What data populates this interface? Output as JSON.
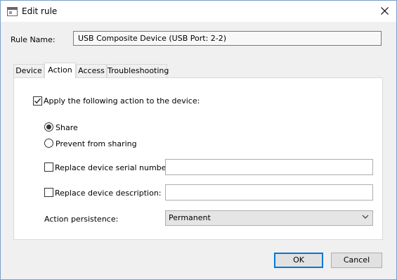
{
  "window": {
    "title": "Edit rule"
  },
  "rule": {
    "label": "Rule Name:",
    "value": "USB Composite Device (USB Port: 2-2)"
  },
  "tabs": [
    {
      "label": "Device",
      "active": false
    },
    {
      "label": "Action",
      "active": true
    },
    {
      "label": "Access",
      "active": false
    },
    {
      "label": "Troubleshooting",
      "active": false
    }
  ],
  "action": {
    "apply_label": "Apply the following action to the device:",
    "apply_checked": true,
    "share_label": "Share",
    "share_selected": true,
    "prevent_label": "Prevent from sharing",
    "prevent_selected": false,
    "serial_label": "Replace device serial number:",
    "serial_checked": false,
    "serial_value": "",
    "description_label": "Replace device description:",
    "description_checked": false,
    "description_value": "",
    "persistence_label": "Action persistence:",
    "persistence_value": "Permanent"
  },
  "buttons": {
    "ok": "OK",
    "cancel": "Cancel"
  },
  "icons": {
    "app": "window-icon",
    "close": "close-icon",
    "dropdown": "chevron-down-icon",
    "check": "checkmark-icon"
  }
}
